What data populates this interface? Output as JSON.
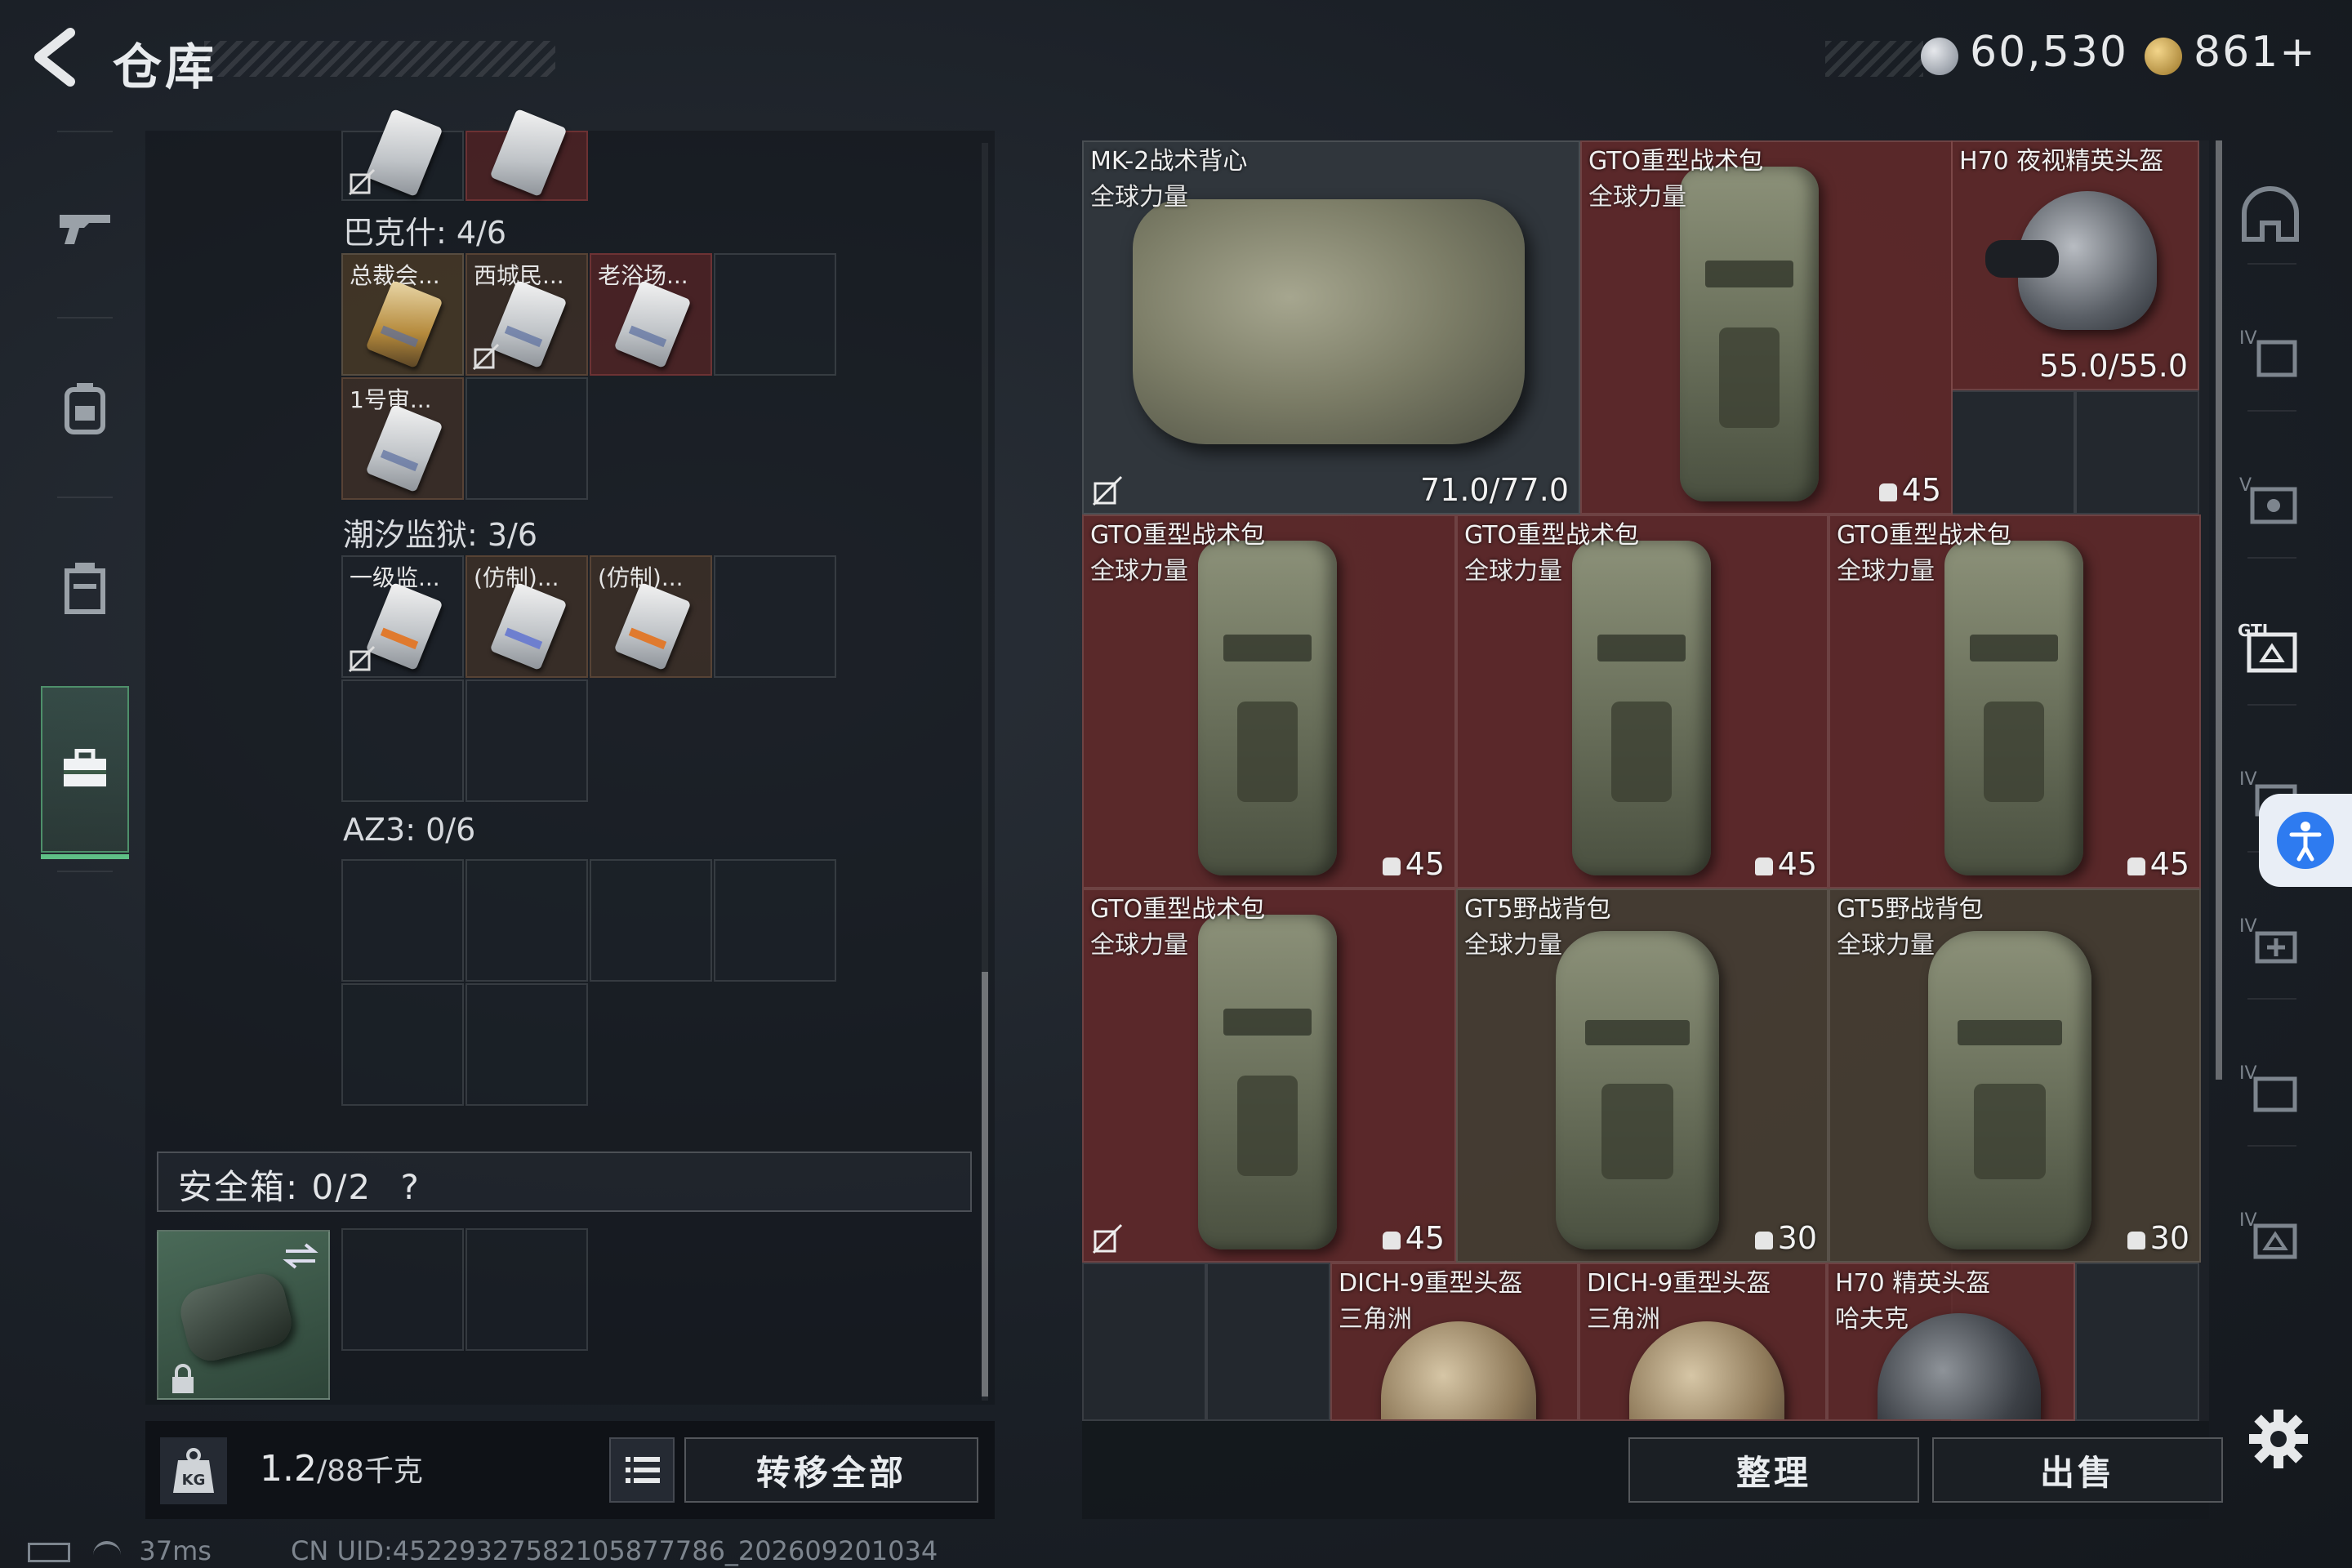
{
  "header": {
    "title": "仓库",
    "currency1": "60,530",
    "currency2": "861+"
  },
  "left_rail": [
    "gun-icon",
    "backpack-icon",
    "vest-icon",
    "toolbox-icon"
  ],
  "storage": {
    "groups": [
      {
        "label": "巴克什: 4/6",
        "items": [
          "总裁会...",
          "西城民...",
          "老浴场...",
          "1号审..."
        ]
      },
      {
        "label": "潮汐监狱: 3/6",
        "items": [
          "一级监...",
          "(仿制)...",
          "(仿制)..."
        ]
      },
      {
        "label": "AZ3: 0/6",
        "items": []
      }
    ],
    "safebox": {
      "label": "安全箱: 0/2",
      "help": "?"
    }
  },
  "bottom": {
    "weight_value": "1.2",
    "weight_max": "/88千克",
    "transfer_all": "转移全部",
    "organize": "整理",
    "sell": "出售"
  },
  "status": {
    "latency": "37ms",
    "uid": "CN UID:4522932758210587778­6_202609201034"
  },
  "items": [
    {
      "name": "MK-2战术背心",
      "sub": "全球力量",
      "value": "71.0/77.0"
    },
    {
      "name": "GTO重型战术包",
      "sub": "全球力量",
      "value": "45"
    },
    {
      "name": "H70 夜视精英头盔",
      "sub": "",
      "value": "55.0/55.0"
    },
    {
      "name": "GTO重型战术包",
      "sub": "全球力量",
      "value": "45"
    },
    {
      "name": "GTO重型战术包",
      "sub": "全球力量",
      "value": "45"
    },
    {
      "name": "GTO重型战术包",
      "sub": "全球力量",
      "value": "45"
    },
    {
      "name": "GTO重型战术包",
      "sub": "全球力量",
      "value": "45"
    },
    {
      "name": "GT5野战背包",
      "sub": "全球力量",
      "value": "30"
    },
    {
      "name": "GT5野战背包",
      "sub": "全球力量",
      "value": "30"
    },
    {
      "name": "DICH-9重型头盔",
      "sub": "三角洲",
      "value": ""
    },
    {
      "name": "DICH-9重型头盔",
      "sub": "三角洲",
      "value": ""
    },
    {
      "name": "H70 精英头盔",
      "sub": "哈夫克",
      "value": ""
    }
  ],
  "right_rail": [
    "helmet-slot-icon",
    "iv-armor-icon",
    "v-chest-rig-icon",
    "gti-bag-icon",
    "iv-bag-icon",
    "iv-med-icon",
    "iv-case-icon",
    "iv-box-icon"
  ],
  "colors": {
    "item_red": "#692a2a",
    "item_brown": "#4e4234",
    "accent_green": "#4e8f6a",
    "a11y_blue": "#2e7bf0"
  }
}
